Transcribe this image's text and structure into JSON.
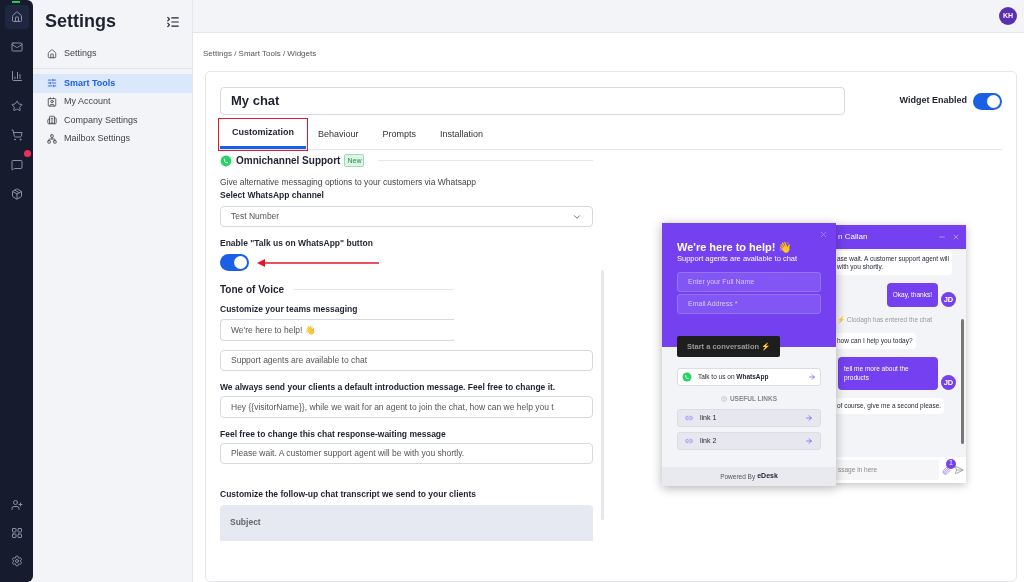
{
  "rail": {
    "items": [
      {
        "kind": "home",
        "selected": true,
        "badge": false
      },
      {
        "kind": "mail",
        "selected": false,
        "badge": false
      },
      {
        "kind": "reports",
        "selected": false,
        "badge": false
      },
      {
        "kind": "star",
        "selected": false,
        "badge": false
      },
      {
        "kind": "cart",
        "selected": false,
        "badge": false
      },
      {
        "kind": "chat",
        "selected": false,
        "badge": true
      },
      {
        "kind": "inbox",
        "selected": false,
        "badge": false
      }
    ],
    "bottom_items": [
      {
        "kind": "add-user"
      },
      {
        "kind": "apps"
      },
      {
        "kind": "settings"
      }
    ]
  },
  "sidebar": {
    "title": "Settings",
    "top_item": {
      "label": "Settings",
      "selected": false
    },
    "items": [
      {
        "label": "Smart Tools",
        "selected": true
      },
      {
        "label": "My Account",
        "selected": false
      },
      {
        "label": "Company Settings",
        "selected": false
      },
      {
        "label": "Mailbox Settings",
        "selected": false
      }
    ]
  },
  "topbar": {
    "avatar": "KH"
  },
  "breadcrumb": "Settings / Smart Tools / Widgets",
  "widget": {
    "name": "My chat",
    "enabled_label": "Widget Enabled",
    "enabled": true
  },
  "tabs": [
    {
      "label": "Customization",
      "selected": true
    },
    {
      "label": "Behaviour",
      "selected": false
    },
    {
      "label": "Prompts",
      "selected": false
    },
    {
      "label": "Installation",
      "selected": false
    }
  ],
  "form": {
    "omnichannel": {
      "title": "Omnichannel Support",
      "badge": "New",
      "description": "Give alternative messaging options to your customers via Whatsapp",
      "select_label": "Select WhatsApp channel",
      "select_value": "Test Number",
      "toggle_label": "Enable \"Talk us on WhatsApp\" button",
      "toggle_on": true
    },
    "tone": {
      "title": "Tone of Voice",
      "label": "Customize your teams messaging",
      "greeting": "We're here to help! 👋",
      "subtitle": "Support agents are available to chat"
    },
    "intro_label": "We always send your clients a default introduction message. Feel free to change it.",
    "intro_value": "Hey {{visitorName}}, while we wait for an agent to join the chat, how can we help you t",
    "waiting_label": "Feel free to change this chat response-waiting message",
    "waiting_value": "Please wait. A customer support agent will be with you shortly.",
    "transcript_label": "Customize the follow-up chat transcript we send to your clients",
    "subject_placeholder": "Subject"
  },
  "preview": {
    "front": {
      "title": "We're here to help! 👋",
      "subtitle": "Support agents are available to chat",
      "name_placeholder": "Enter your Full Name",
      "email_placeholder": "Email Address *",
      "start_button": "Start a conversation ⚡",
      "whatsapp_text": "Talk to us on **WhatsApp**",
      "links_heading": "USEFUL LINKS",
      "links": [
        "link 1",
        "link 2"
      ],
      "powered_by": "Powered By",
      "brand": "eDesk"
    },
    "back": {
      "title": "n Callan",
      "messages": [
        {
          "kind": "agent",
          "text": "ase wait. A customer support agent will with you shortly."
        },
        {
          "kind": "visitor",
          "text": "Okay, thanks!",
          "avatar": "JD"
        },
        {
          "kind": "event",
          "text": "⚡ Clodagh has entered the chat"
        },
        {
          "kind": "agent",
          "text": "how can I help you today?"
        },
        {
          "kind": "visitor",
          "text": "tell me more about the products",
          "avatar": "JD"
        },
        {
          "kind": "agent",
          "text": "of course, give me a second please."
        }
      ],
      "input_placeholder": "ssage in here",
      "attachment_count": "1"
    }
  }
}
